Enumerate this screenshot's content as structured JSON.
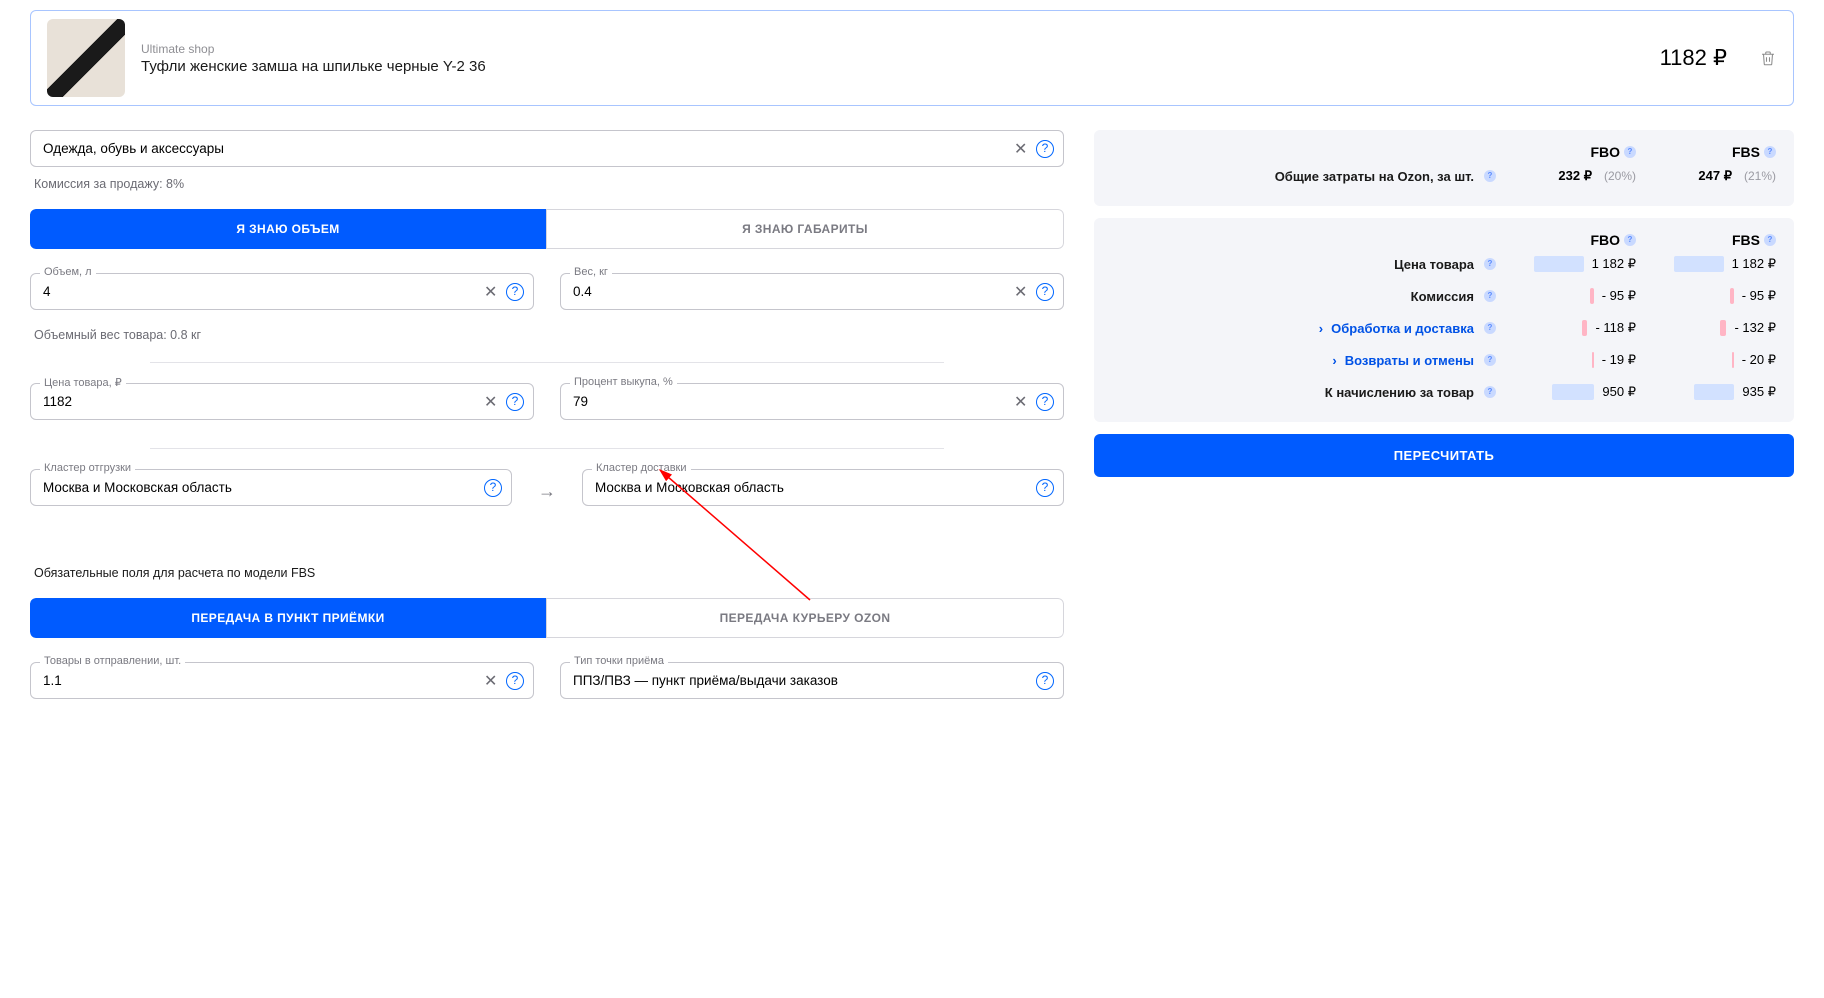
{
  "product": {
    "brand": "Ultimate shop",
    "title": "Туфли женские замша на шпильке черные Y-2 36",
    "price": "1182 ₽"
  },
  "category": {
    "value": "Одежда, обувь и аксессуары"
  },
  "commission_line": "Комиссия за продажу: 8%",
  "tabs_size": {
    "volume": "Я ЗНАЮ ОБЪЕМ",
    "dimensions": "Я ЗНАЮ ГАБАРИТЫ"
  },
  "fields": {
    "volume": {
      "label": "Объем, л",
      "value": "4"
    },
    "weight": {
      "label": "Вес, кг",
      "value": "0.4"
    },
    "price": {
      "label": "Цена товара, ₽",
      "value": "1182"
    },
    "buyout": {
      "label": "Процент выкупа, %",
      "value": "79"
    },
    "cluster_from": {
      "label": "Кластер отгрузки",
      "value": "Москва и Московская область"
    },
    "cluster_to": {
      "label": "Кластер доставки",
      "value": "Москва и Московская область"
    },
    "items_in_shipment": {
      "label": "Товары в отправлении, шт.",
      "value": "1.1"
    },
    "pickup_type": {
      "label": "Тип точки приёма",
      "value": "ППЗ/ПВЗ — пункт приёма/выдачи заказов"
    }
  },
  "volumetric_line": "Объемный вес товара: 0.8 кг",
  "fbs_heading": "Обязательные поля для расчета по модели FBS",
  "tabs_handover": {
    "pickup": "ПЕРЕДАЧА В ПУНКТ ПРИЁМКИ",
    "courier": "ПЕРЕДАЧА КУРЬЕРУ OZON"
  },
  "summary": {
    "fbo_label": "FBO",
    "fbs_label": "FBS",
    "ozon_total": {
      "label": "Общие затраты на Ozon, за шт.",
      "fbo_value": "232 ₽",
      "fbo_pct": "(20%)",
      "fbs_value": "247 ₽",
      "fbs_pct": "(21%)"
    },
    "rows": {
      "price": {
        "label": "Цена товара",
        "fbo": "1 182 ₽",
        "fbs": "1 182 ₽"
      },
      "commission": {
        "label": "Комиссия",
        "fbo": "- 95 ₽",
        "fbs": "- 95 ₽"
      },
      "processing": {
        "label": "Обработка и доставка",
        "fbo": "- 118 ₽",
        "fbs": "- 132 ₽"
      },
      "returns": {
        "label": "Возвраты и отмены",
        "fbo": "- 19 ₽",
        "fbs": "- 20 ₽"
      },
      "payout": {
        "label": "К начислению за товар",
        "fbo": "950 ₽",
        "fbs": "935 ₽"
      }
    }
  },
  "recalc_label": "ПЕРЕСЧИТАТЬ"
}
